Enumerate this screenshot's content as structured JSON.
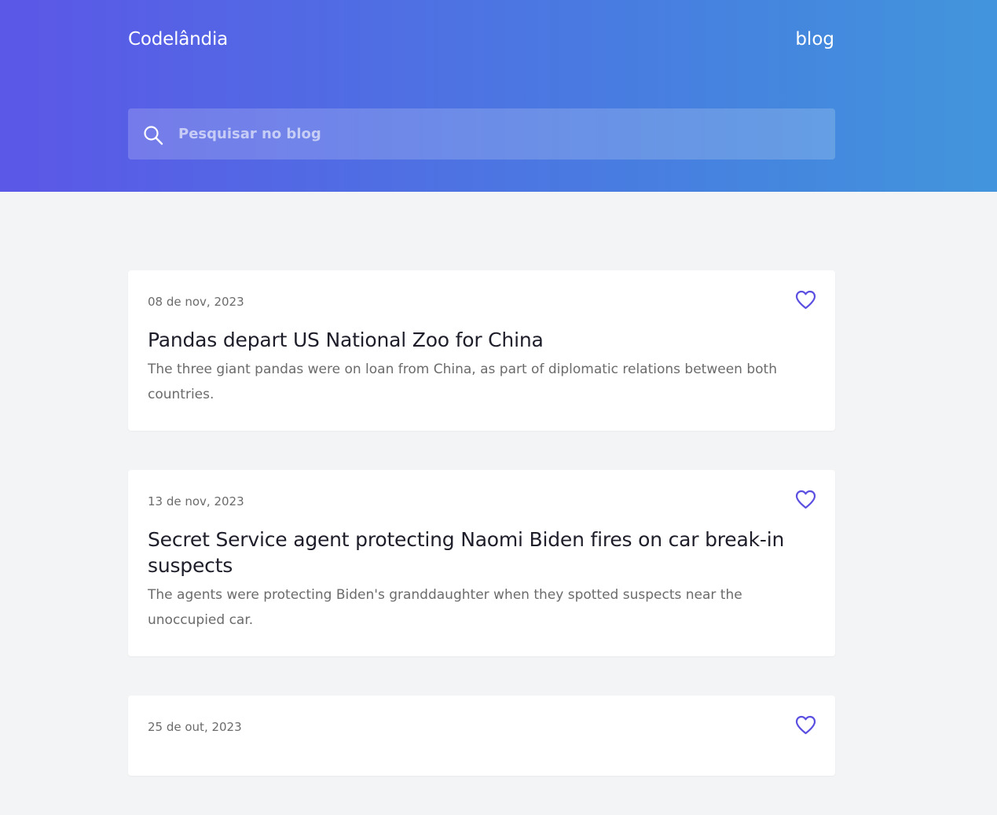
{
  "header": {
    "brand": "Codelândia",
    "nav_blog": "blog"
  },
  "search": {
    "placeholder": "Pesquisar no blog",
    "value": ""
  },
  "colors": {
    "gradient_start": "#5b57e7",
    "gradient_end": "#4295dc",
    "accent": "#5a4fe0",
    "background": "#f3f4f6"
  },
  "icons": {
    "search": "search-icon",
    "like": "heart-icon"
  },
  "posts": [
    {
      "date": "08 de nov, 2023",
      "title": "Pandas depart US National Zoo for China",
      "excerpt": "The three giant pandas were on loan from China, as part of diplomatic relations between both countries."
    },
    {
      "date": "13 de nov, 2023",
      "title": "Secret Service agent protecting Naomi Biden fires on car break-in suspects",
      "excerpt": "The agents were protecting Biden's granddaughter when they spotted suspects near the unoccupied car."
    },
    {
      "date": "25 de out, 2023",
      "title": "",
      "excerpt": ""
    }
  ]
}
